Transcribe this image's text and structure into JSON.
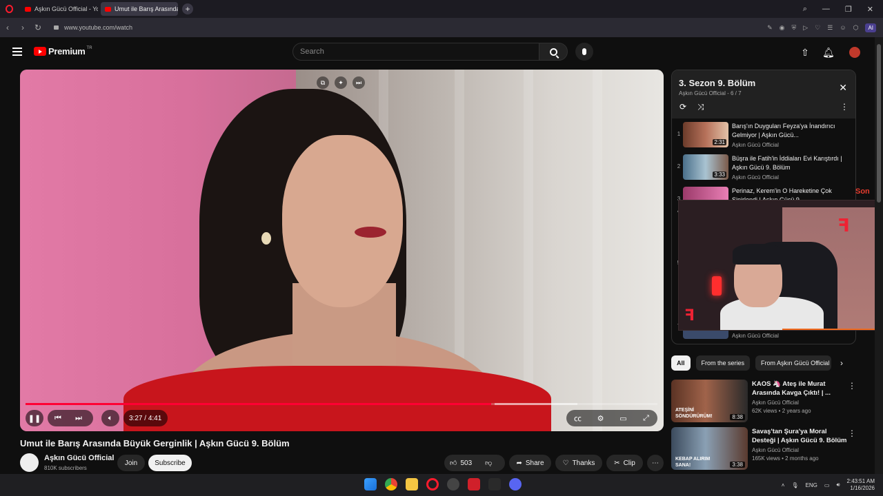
{
  "browser": {
    "tabs": [
      {
        "label": "Aşkın Gücü Official - YouT",
        "active": false
      },
      {
        "label": "Umut ile Barış Arasında",
        "active": true
      }
    ],
    "url": "www.youtube.com/watch",
    "ai_label": "AI"
  },
  "header": {
    "logo": "Premium",
    "region": "TR",
    "search_placeholder": "Search"
  },
  "player": {
    "current_time": "3:27",
    "separator": "/",
    "duration": "4:41",
    "progress_fraction": 0.737,
    "accent": "#ff0033"
  },
  "video": {
    "title": "Umut ile Barış Arasında Büyük Gerginlik | Aşkın Gücü 9. Bölüm",
    "channel": "Aşkın Gücü Official",
    "subscribers": "810K subscribers",
    "join_label": "Join",
    "subscribe_label": "Subscribe",
    "likes": "503",
    "share_label": "Share",
    "thanks_label": "Thanks",
    "clip_label": "Clip"
  },
  "playlist": {
    "title": "3. Sezon 9. Bölüm",
    "channel": "Aşkın Gücü Official",
    "position": "6 / 7",
    "items": [
      {
        "num": "1",
        "title": "Barış'ın Duyguları Feyza'ya İnandırıcı Gelmiyor | Aşkın Gücü...",
        "channel": "Aşkın Gücü Official",
        "duration": "2:31"
      },
      {
        "num": "2",
        "title": "Büşra ile Fatih'in İddiaları Evi Karıştırdı | Aşkın Gücü 9. Bölüm",
        "channel": "Aşkın Gücü Official",
        "duration": "3:33"
      },
      {
        "num": "3",
        "title": "Perinaz, Kerem'in O Hareketine Çok Sinirlendi | Aşkın Gücü 9....",
        "channel": "",
        "duration": ""
      },
      {
        "num": "4",
        "title": "",
        "channel": "",
        "duration": ""
      },
      {
        "num": "5",
        "title": "",
        "channel": "",
        "duration": ""
      },
      {
        "num": "7",
        "title": "",
        "channel": "Aşkın Gücü Official",
        "duration": ""
      }
    ]
  },
  "overlay": {
    "son_text": "Son"
  },
  "chips": [
    "All",
    "From the series",
    "From Aşkın Gücü Official"
  ],
  "related": [
    {
      "title": "KAOS 🦄 Ateş ile Murat Arasında Kavga Çıktı! | ...",
      "channel": "Aşkın Gücü Official",
      "meta": "62K views • 2 years ago",
      "duration": "8:38",
      "thumb_caption": "ATEŞİNİ SÖNDÜRÜRÜM!"
    },
    {
      "title": "Savaş'tan Şura'ya Moral Desteği | Aşkın Gücü 9. Bölüm",
      "channel": "Aşkın Gücü Official",
      "meta": "165K views • 2 months ago",
      "duration": "3:38",
      "thumb_caption": "KEBAP ALIRIM SANA!"
    }
  ],
  "taskbar": {
    "lang": "ENG",
    "time": "2:43:51 AM",
    "date": "1/16/2026"
  }
}
